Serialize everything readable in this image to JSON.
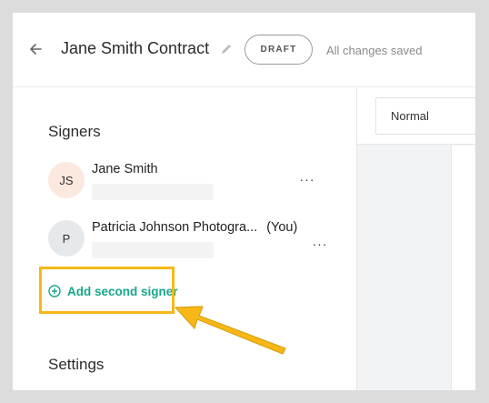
{
  "header": {
    "title": "Jane Smith Contract",
    "status": "DRAFT",
    "save_status": "All changes saved"
  },
  "signers_section": {
    "title": "Signers",
    "signers": [
      {
        "initials": "JS",
        "name": "Jane Smith",
        "you_label": ""
      },
      {
        "initials": "P",
        "name": "Patricia Johnson Photogra...",
        "you_label": "(You)"
      }
    ],
    "more_label": "···",
    "add_signer_label": "Add second signer"
  },
  "settings_section": {
    "title": "Settings"
  },
  "editor": {
    "style_value": "Normal"
  },
  "colors": {
    "accent": "#1aa68a",
    "highlight": "#f7b817"
  }
}
